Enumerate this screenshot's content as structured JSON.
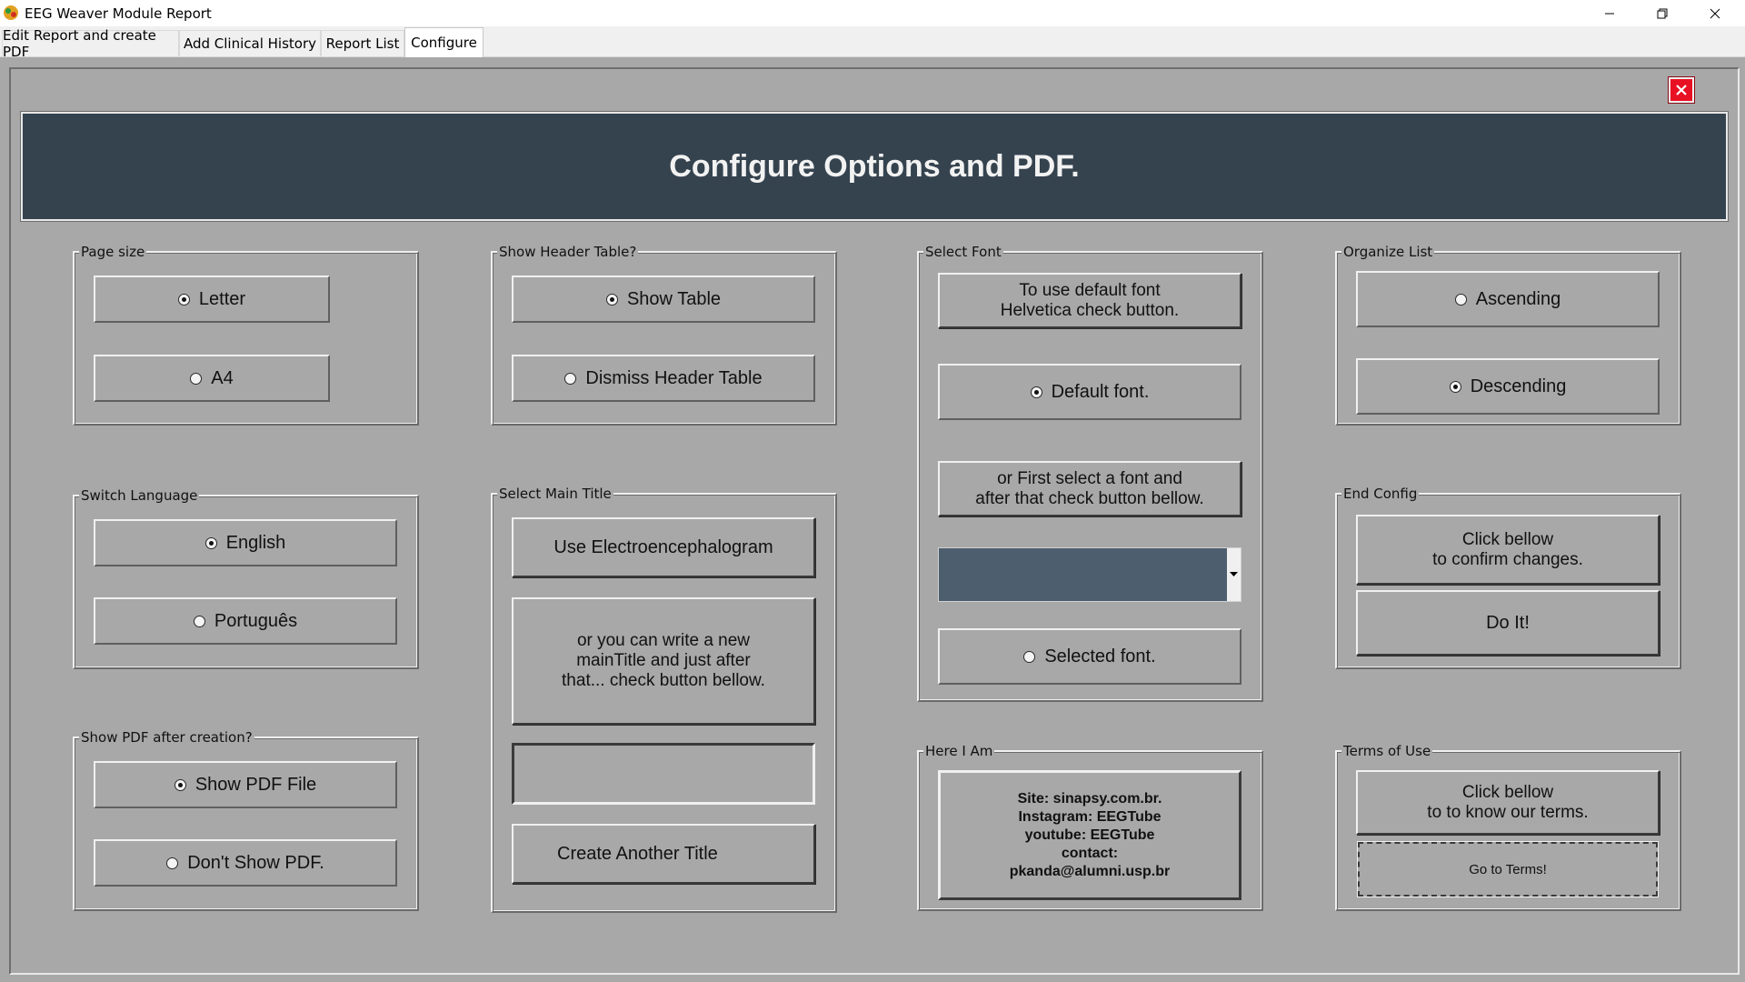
{
  "window": {
    "title": "EEG Weaver Module Report",
    "close_color": "#e81123"
  },
  "tabs": [
    {
      "label": "Edit Report and create PDF"
    },
    {
      "label": "Add Clinical History"
    },
    {
      "label": "Report List"
    },
    {
      "label": "Configure",
      "active": true
    }
  ],
  "banner": {
    "title": "Configure Options and PDF.",
    "bg": "#35434f"
  },
  "page_size": {
    "label": "Page size",
    "options": [
      {
        "label": "Letter",
        "selected": true
      },
      {
        "label": "A4",
        "selected": false
      }
    ]
  },
  "header_table": {
    "label": "Show Header Table?",
    "options": [
      {
        "label": "Show Table",
        "selected": true
      },
      {
        "label": "Dismiss Header Table",
        "selected": false
      }
    ]
  },
  "select_font": {
    "label": "Select Font",
    "info_default": "To use default font\nHelvetica check button.",
    "default_option": "Default font.",
    "info_select": "or First select a font and\nafter that check button bellow.",
    "selected_option": "Selected font.",
    "combo_value": ""
  },
  "organize_list": {
    "label": "Organize List",
    "options": [
      {
        "label": "Ascending",
        "selected": false
      },
      {
        "label": "Descending",
        "selected": true
      }
    ]
  },
  "language": {
    "label": "Switch Language",
    "options": [
      {
        "label": "English",
        "selected": true
      },
      {
        "label": "Português",
        "selected": false
      }
    ]
  },
  "main_title": {
    "label": "Select Main Title",
    "use_button": "Use Electroencephalogram",
    "info": "or you can write a new\nmainTitle and just after\nthat... check button bellow.",
    "input_value": "",
    "create_button": "Create Another Title"
  },
  "end_config": {
    "label": "End Config",
    "info": "Click bellow\nto confirm changes.",
    "do_button": "Do It!"
  },
  "show_pdf": {
    "label": "Show PDF after creation?",
    "options": [
      {
        "label": "Show PDF File",
        "selected": true
      },
      {
        "label": "Don't Show PDF.",
        "selected": false
      }
    ]
  },
  "here_i_am": {
    "label": "Here I Am",
    "lines": [
      "Site: sinapsy.com.br.",
      "Instagram: EEGTube",
      "youtube: EEGTube",
      "contact:",
      "pkanda@alumni.usp.br"
    ]
  },
  "terms": {
    "label": "Terms of Use",
    "info": "Click bellow\nto to know our terms.",
    "button": "Go to Terms!"
  }
}
